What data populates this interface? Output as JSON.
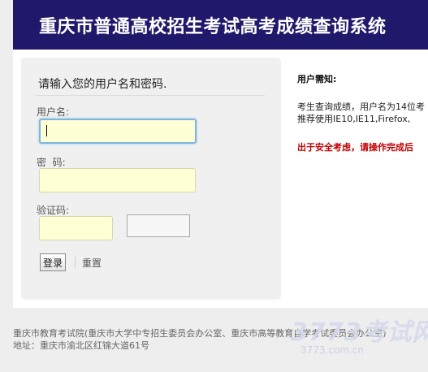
{
  "header": {
    "title": "重庆市普通高校招生考试高考成绩查询系统"
  },
  "login": {
    "title": "请输入您的用户名和密码.",
    "username_label": "用户名:",
    "username_value": "",
    "password_label": "密  码:",
    "password_value": "",
    "captcha_label": "验证码:",
    "captcha_value": "",
    "login_button": "登录",
    "reset_link": "重置"
  },
  "notice": {
    "title": "用户需知:",
    "line1": "考生查询成绩，用户名为14位考",
    "line2": "推荐使用IE10,IE11,Firefox,",
    "warning": "出于安全考虑，请操作完成后"
  },
  "footer": {
    "line1": "重庆市教育考试院(重庆市大学中专招生委员会办公室、重庆市高等教育自学考试委员会办公室)",
    "line2": "地址：重庆市渝北区红锦大道61号"
  },
  "watermark": {
    "main": "3773考试网",
    "sub": "3773.com.cn"
  },
  "colors": {
    "header_bg": "#20196b",
    "input_bg": "#ffffd6",
    "warning": "#c00000"
  }
}
